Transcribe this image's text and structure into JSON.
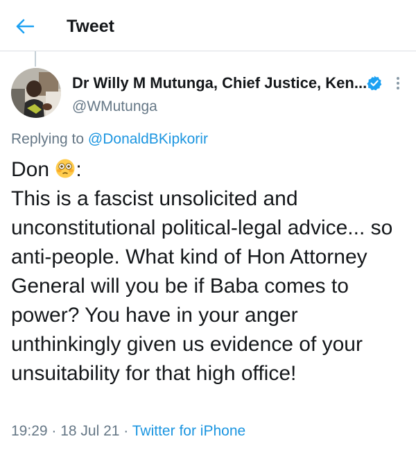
{
  "header": {
    "title": "Tweet",
    "back_icon": "arrow-left-icon",
    "accent_color": "#1da1f2"
  },
  "author": {
    "name": "Dr Willy M Mutunga, Chief Justice, Ken...",
    "handle": "@WMutunga",
    "verified": true,
    "verified_icon": "verified-badge-icon",
    "more_icon": "more-vertical-icon"
  },
  "reply": {
    "prefix": "Replying to ",
    "to": "@DonaldBKipkorir"
  },
  "tweet": {
    "greeting": "Don",
    "emoji": "flushed-face-emoji",
    "greeting_suffix": ":",
    "text": "This is a fascist unsolicited and unconstitutional political-legal advice... so anti-people. What kind of Hon Attorney General will you be if Baba comes to power? You have in your anger unthinkingly given us evidence of your unsuitability for that high office!"
  },
  "meta": {
    "time": "19:29",
    "sep1": " · ",
    "date": "18 Jul 21",
    "sep2": " · ",
    "source": "Twitter for iPhone"
  }
}
